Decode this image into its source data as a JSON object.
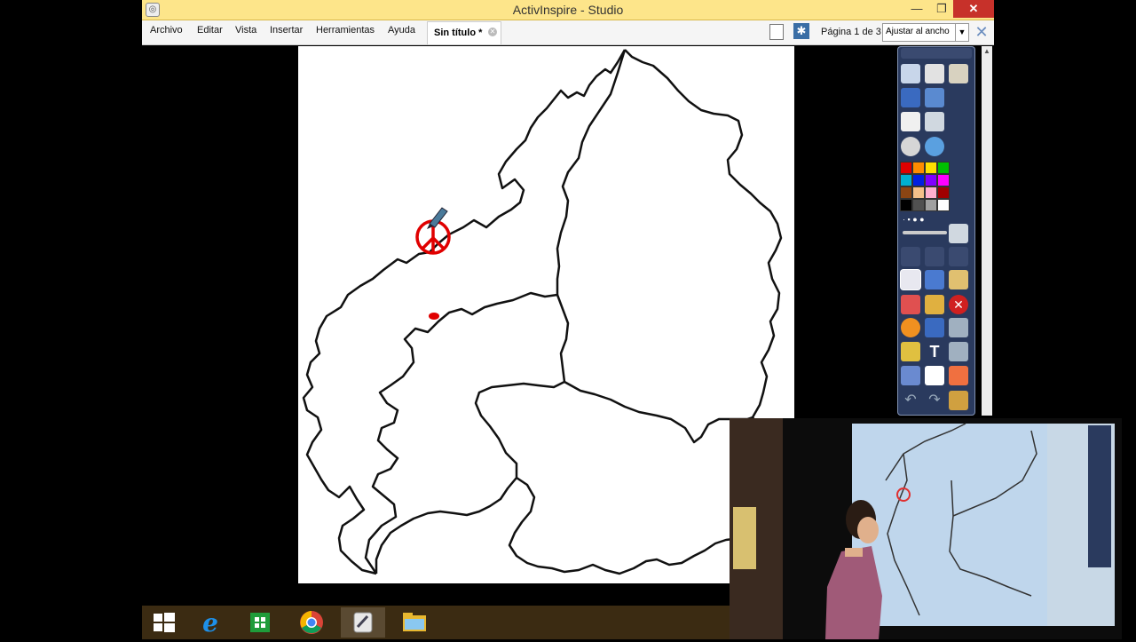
{
  "window": {
    "title": "ActivInspire - Studio",
    "controls": {
      "minimize": "—",
      "maximize": "❐",
      "close": "✕"
    }
  },
  "menu": {
    "items": [
      "Archivo",
      "Editar",
      "Vista",
      "Insertar",
      "Herramientas",
      "Ayuda"
    ]
  },
  "document_tab": {
    "label": "Sin título *"
  },
  "page_indicator": "Página 1 de 3",
  "zoom": {
    "selected": "Ajustar al ancho"
  },
  "toolbox": {
    "colors": [
      "#e00000",
      "#ff8c00",
      "#ffe000",
      "#00c000",
      "#00b0d0",
      "#0020e0",
      "#8000ff",
      "#ff00ff",
      "#8b4513",
      "#f4c08a",
      "#ffb0d0",
      "#a00000",
      "#000000",
      "#505050",
      "#a0a0a0",
      "#ffffff"
    ]
  },
  "taskbar": {
    "items": [
      "start-icon",
      "internet-explorer-icon",
      "store-icon",
      "chrome-icon",
      "activinspire-icon",
      "file-explorer-icon"
    ]
  }
}
